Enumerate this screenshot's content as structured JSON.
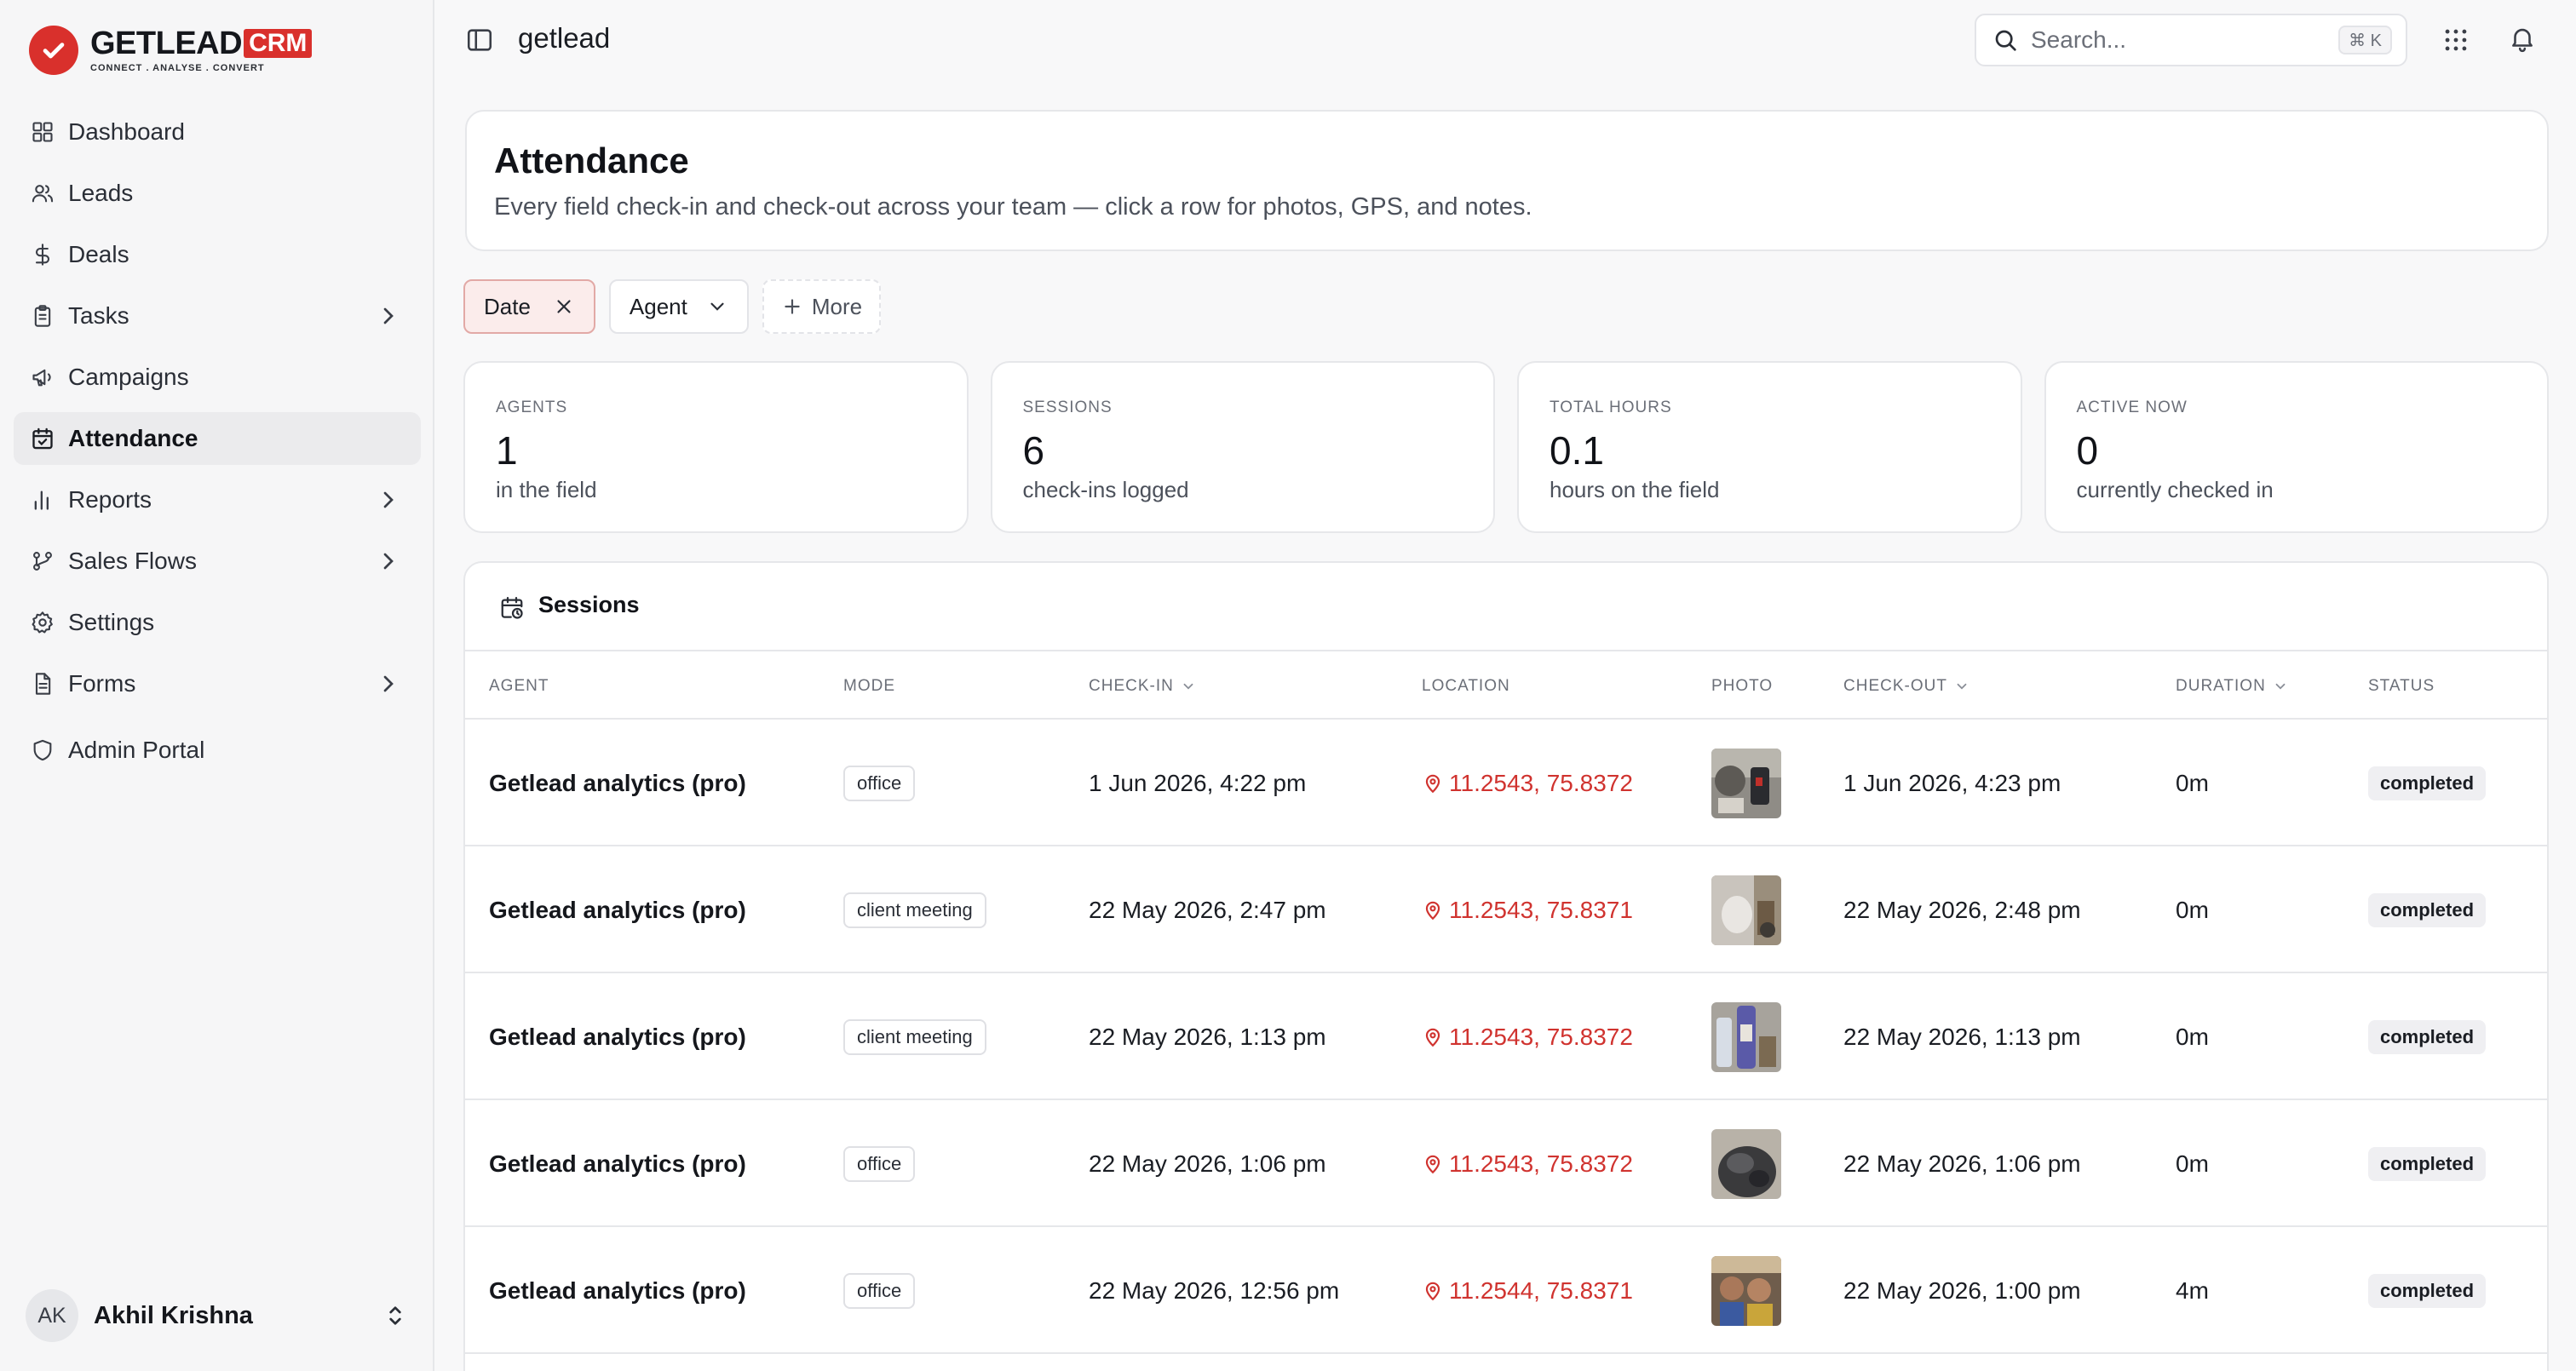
{
  "brand": {
    "name": "GETLEAD",
    "badge": "CRM",
    "tagline": "CONNECT  .  ANALYSE  .  CONVERT",
    "color": "#d9302c"
  },
  "sidebar": {
    "items": [
      {
        "label": "Dashboard",
        "icon": "grid-icon",
        "chevron": false,
        "active": false
      },
      {
        "label": "Leads",
        "icon": "users-icon",
        "chevron": false,
        "active": false
      },
      {
        "label": "Deals",
        "icon": "dollar-icon",
        "chevron": false,
        "active": false
      },
      {
        "label": "Tasks",
        "icon": "clipboard-icon",
        "chevron": true,
        "active": false
      },
      {
        "label": "Campaigns",
        "icon": "megaphone-icon",
        "chevron": false,
        "active": false
      },
      {
        "label": "Attendance",
        "icon": "calendar-check-icon",
        "chevron": false,
        "active": true
      },
      {
        "label": "Reports",
        "icon": "bar-chart-icon",
        "chevron": true,
        "active": false
      },
      {
        "label": "Sales Flows",
        "icon": "branch-icon",
        "chevron": true,
        "active": false
      },
      {
        "label": "Settings",
        "icon": "gear-icon",
        "chevron": false,
        "active": false
      },
      {
        "label": "Forms",
        "icon": "document-icon",
        "chevron": true,
        "active": false
      },
      {
        "label": "Admin Portal",
        "icon": "shield-icon",
        "chevron": false,
        "active": false
      }
    ],
    "user": {
      "initials": "AK",
      "name": "Akhil Krishna"
    }
  },
  "topbar": {
    "org": "getlead",
    "search_placeholder": "Search...",
    "shortcut": "⌘ K"
  },
  "page": {
    "title": "Attendance",
    "subtitle": "Every field check-in and check-out across your team — click a row for photos, GPS, and notes."
  },
  "filters": {
    "date": "Date",
    "agent": "Agent",
    "more": "More"
  },
  "stats": [
    {
      "caption": "AGENTS",
      "value": "1",
      "note": "in the field"
    },
    {
      "caption": "SESSIONS",
      "value": "6",
      "note": "check-ins logged"
    },
    {
      "caption": "TOTAL HOURS",
      "value": "0.1",
      "note": "hours on the field"
    },
    {
      "caption": "ACTIVE NOW",
      "value": "0",
      "note": "currently checked in"
    }
  ],
  "sessions": {
    "title": "Sessions",
    "columns": [
      "AGENT",
      "MODE",
      "CHECK-IN",
      "LOCATION",
      "PHOTO",
      "CHECK-OUT",
      "DURATION",
      "STATUS"
    ],
    "rows": [
      {
        "agent": "Getlead analytics (pro)",
        "mode": "office",
        "check_in": "1 Jun 2026, 4:22 pm",
        "location": "11.2543, 75.8372",
        "check_out": "1 Jun 2026, 4:23 pm",
        "duration": "0m",
        "status": "completed"
      },
      {
        "agent": "Getlead analytics (pro)",
        "mode": "client meeting",
        "check_in": "22 May 2026, 2:47 pm",
        "location": "11.2543, 75.8371",
        "check_out": "22 May 2026, 2:48 pm",
        "duration": "0m",
        "status": "completed"
      },
      {
        "agent": "Getlead analytics (pro)",
        "mode": "client meeting",
        "check_in": "22 May 2026, 1:13 pm",
        "location": "11.2543, 75.8372",
        "check_out": "22 May 2026, 1:13 pm",
        "duration": "0m",
        "status": "completed"
      },
      {
        "agent": "Getlead analytics (pro)",
        "mode": "office",
        "check_in": "22 May 2026, 1:06 pm",
        "location": "11.2543, 75.8372",
        "check_out": "22 May 2026, 1:06 pm",
        "duration": "0m",
        "status": "completed"
      },
      {
        "agent": "Getlead analytics (pro)",
        "mode": "office",
        "check_in": "22 May 2026, 12:56 pm",
        "location": "11.2544, 75.8371",
        "check_out": "22 May 2026, 1:00 pm",
        "duration": "4m",
        "status": "completed"
      }
    ]
  }
}
